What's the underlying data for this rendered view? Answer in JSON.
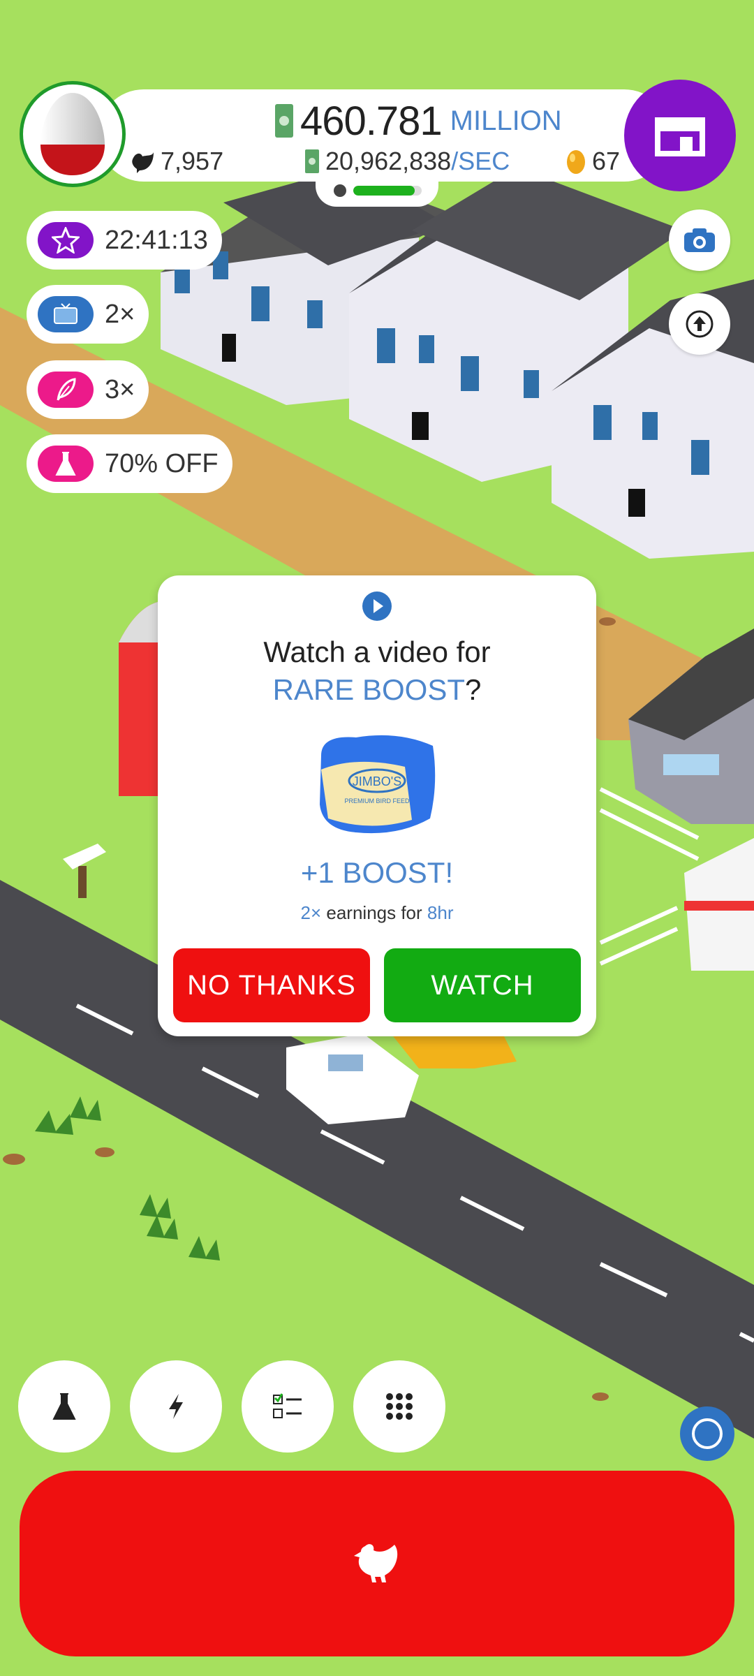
{
  "colors": {
    "grass": "#a6e05e",
    "road": "#4a4a4f",
    "dirt": "#d9a85a",
    "accent_purple": "#8214c8",
    "no_thanks": "#ef1010",
    "watch": "#12ab12",
    "text_blue": "#4d86cc"
  },
  "header": {
    "money_amount": "460.781",
    "money_unit": "MILLION",
    "rate_value": "20,962,838",
    "rate_unit": "/SEC",
    "chicken_count": "7,957",
    "golden_eggs": "67",
    "progress_fraction": 0.9
  },
  "boosts": [
    {
      "icon": "star-icon",
      "label": "22:41:13"
    },
    {
      "icon": "video-icon",
      "label": "2×"
    },
    {
      "icon": "feather-icon",
      "label": "3×"
    },
    {
      "icon": "flask-icon",
      "label": "70% OFF"
    }
  ],
  "dialog": {
    "line1": "Watch a video for",
    "highlight": "RARE BOOST",
    "question_mark": "?",
    "feed_brand": "JIMBO'S",
    "feed_sub": "PREMIUM BIRD FEED",
    "boost_text": "+1 BOOST!",
    "earnings_prefix": "2×",
    "earnings_mid": " earnings for ",
    "earnings_time": "8hr",
    "no_thanks": "NO THANKS",
    "watch": "WATCH"
  },
  "bottom_bar": [
    "flask-icon",
    "lightning-icon",
    "checklist-icon",
    "grid-icon"
  ],
  "hatch_icon": "chicken-icon"
}
